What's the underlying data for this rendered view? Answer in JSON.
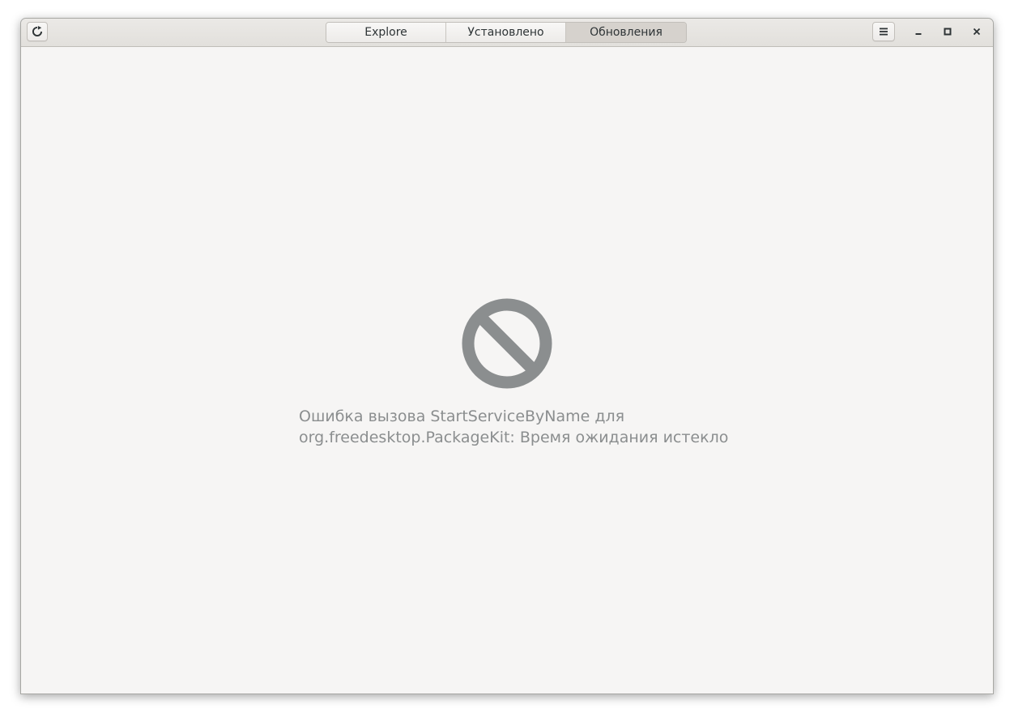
{
  "window": {
    "header": {
      "refresh_icon": "view-refresh-icon",
      "menu_icon": "open-menu-icon",
      "tabs": [
        {
          "label": "Explore",
          "active": false
        },
        {
          "label": "Установлено",
          "active": false
        },
        {
          "label": "Обновления",
          "active": true
        }
      ],
      "window_controls": [
        "minimize-icon",
        "maximize-icon",
        "close-icon"
      ]
    },
    "content": {
      "status_icon": "action-unavailable-icon",
      "error_line1": "Ошибка вызова StartServiceByName для",
      "error_line2": "org.freedesktop.PackageKit: Время ожидания истекло"
    }
  },
  "colors": {
    "window_bg": "#f6f5f4",
    "header_bg": "#e8e6e3",
    "active_tab": "#d6d2cd",
    "icon_gray": "#8b8e8f",
    "text_gray": "#8b8e8f"
  }
}
